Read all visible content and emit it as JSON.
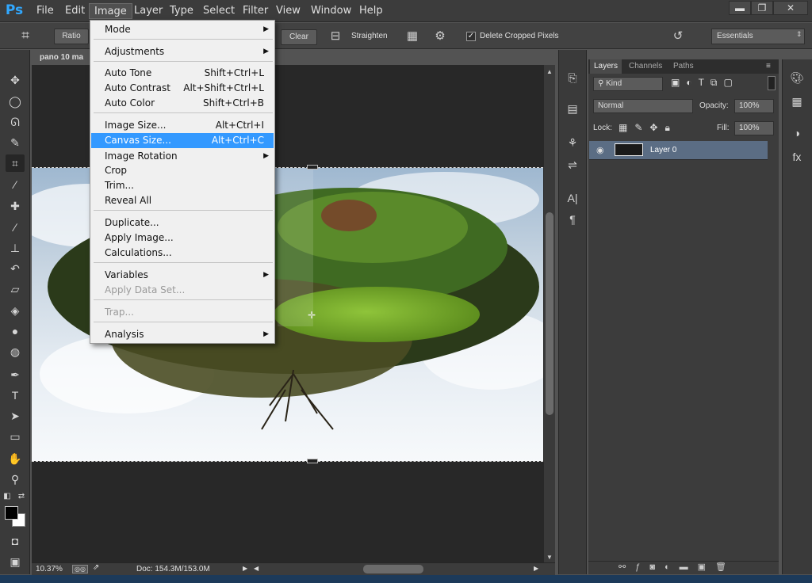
{
  "app": {
    "logo": "Ps"
  },
  "menubar": {
    "items": [
      "File",
      "Edit",
      "Image",
      "Layer",
      "Type",
      "Select",
      "Filter",
      "View",
      "Window",
      "Help"
    ],
    "active": "Image"
  },
  "window_controls": {
    "minimize": "▬",
    "restore": "❐",
    "close": "✕"
  },
  "options": {
    "ratio": "Ratio",
    "clear": "Clear",
    "straighten": "Straighten",
    "delete_cropped": "Delete Cropped Pixels",
    "delete_cropped_checked": true,
    "workspace": "Essentials"
  },
  "document": {
    "tab_title": "pano 10 ma",
    "zoom": "10.37%",
    "doc_size": "Doc: 154.3M/153.0M"
  },
  "image_menu": {
    "items": [
      {
        "label": "Mode",
        "shortcut": "",
        "submenu": true
      },
      {
        "label": "Adjustments",
        "shortcut": "",
        "submenu": true
      },
      {
        "label": "Auto Tone",
        "shortcut": "Shift+Ctrl+L"
      },
      {
        "label": "Auto Contrast",
        "shortcut": "Alt+Shift+Ctrl+L"
      },
      {
        "label": "Auto Color",
        "shortcut": "Shift+Ctrl+B"
      },
      {
        "label": "Image Size...",
        "shortcut": "Alt+Ctrl+I"
      },
      {
        "label": "Canvas Size...",
        "shortcut": "Alt+Ctrl+C",
        "highlighted": true
      },
      {
        "label": "Image Rotation",
        "shortcut": "",
        "submenu": true
      },
      {
        "label": "Crop",
        "shortcut": ""
      },
      {
        "label": "Trim...",
        "shortcut": ""
      },
      {
        "label": "Reveal All",
        "shortcut": ""
      },
      {
        "label": "Duplicate...",
        "shortcut": ""
      },
      {
        "label": "Apply Image...",
        "shortcut": ""
      },
      {
        "label": "Calculations...",
        "shortcut": ""
      },
      {
        "label": "Variables",
        "shortcut": "",
        "submenu": true
      },
      {
        "label": "Apply Data Set...",
        "shortcut": "",
        "disabled": true
      },
      {
        "label": "Trap...",
        "shortcut": "",
        "disabled": true
      },
      {
        "label": "Analysis",
        "shortcut": "",
        "submenu": true
      }
    ]
  },
  "layers_panel": {
    "tabs": [
      "Layers",
      "Channels",
      "Paths"
    ],
    "active_tab": "Layers",
    "filter": "Kind",
    "blend_mode": "Normal",
    "opacity_label": "Opacity:",
    "opacity": "100%",
    "lock_label": "Lock:",
    "fill_label": "Fill:",
    "fill": "100%",
    "layers": [
      {
        "name": "Layer 0",
        "visible": true
      }
    ]
  },
  "colors": {
    "menu_highlight": "#3399ff",
    "ps_blue": "#31a8ff",
    "layer_selected": "#5b6d84"
  }
}
